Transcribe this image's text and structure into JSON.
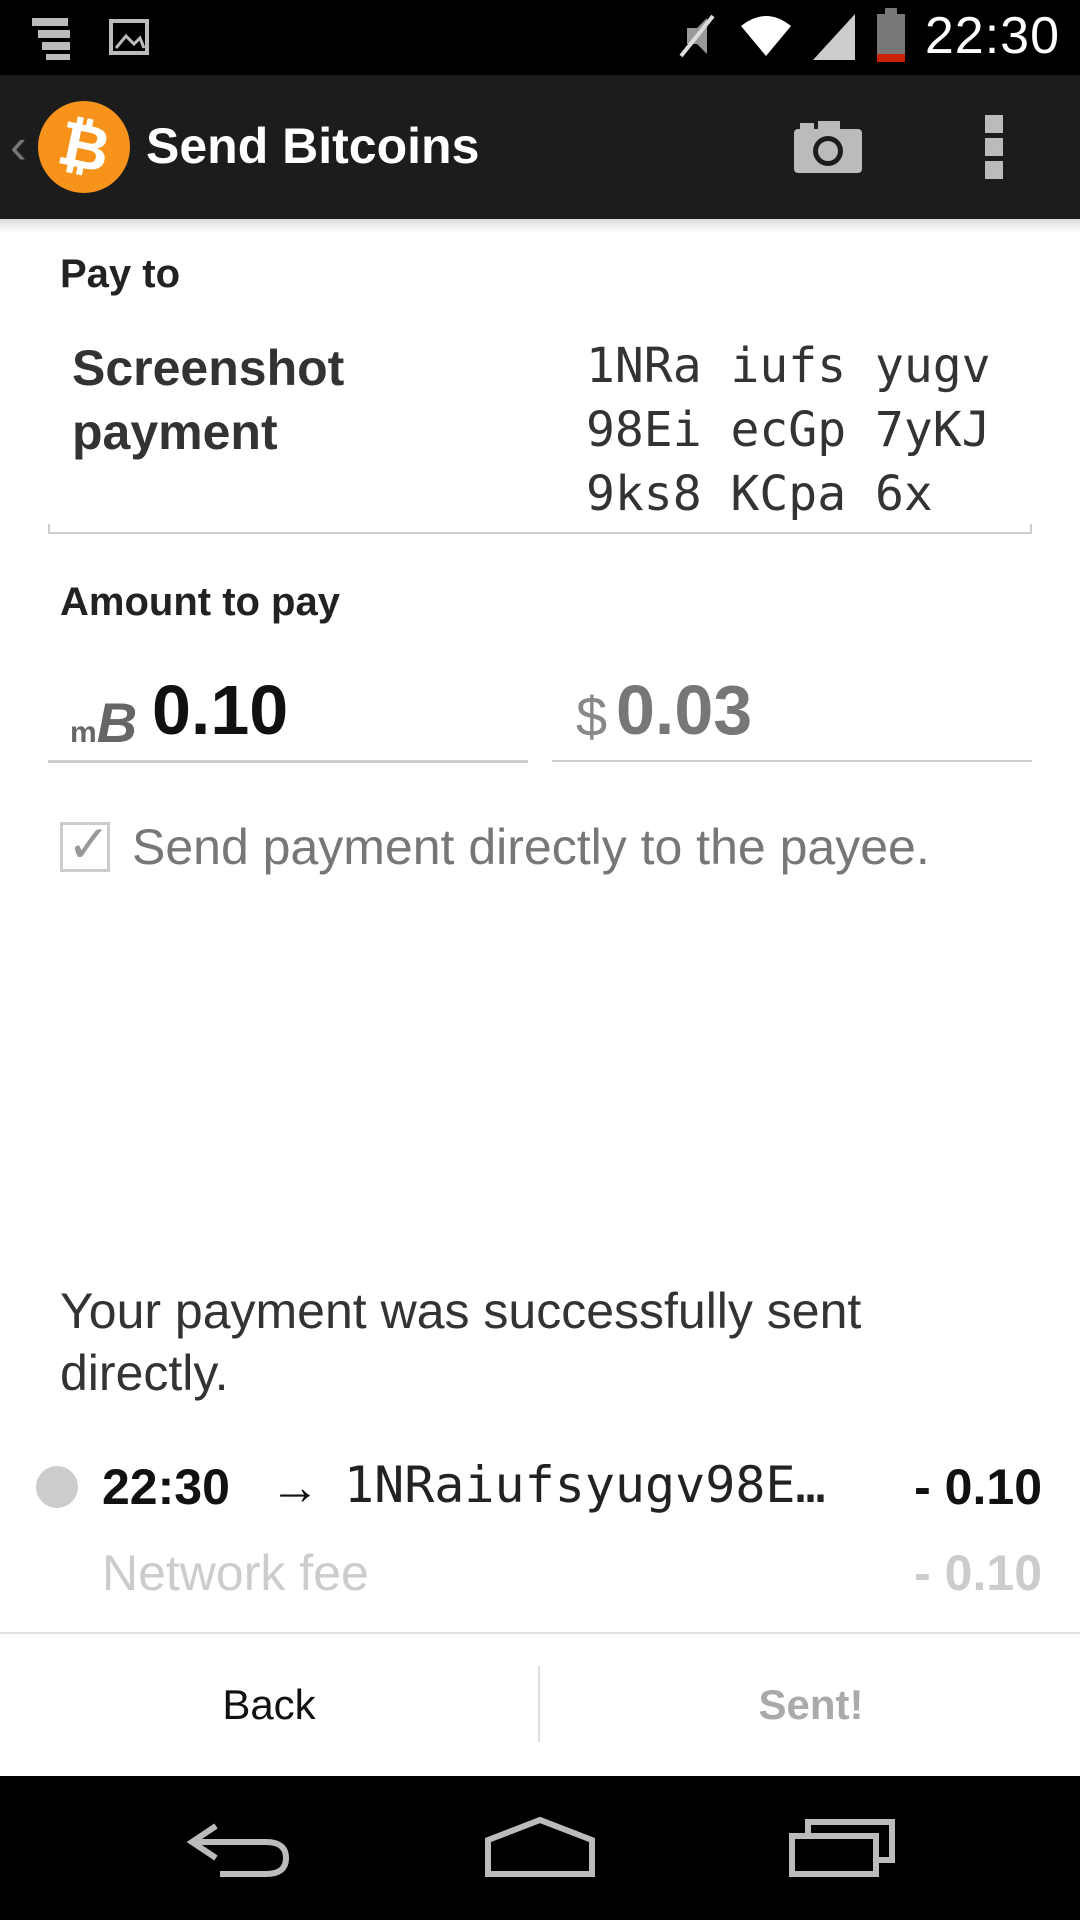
{
  "status_bar": {
    "time": "22:30",
    "icons": [
      "notification-stack-icon",
      "image-notification-icon",
      "mute-icon",
      "wifi-icon",
      "cell-signal-icon",
      "battery-low-icon"
    ]
  },
  "action_bar": {
    "title": "Send Bitcoins",
    "up_caret": "‹",
    "logo_glyph": "₿",
    "icons": [
      "bitcoin-logo-icon",
      "camera-icon",
      "overflow-menu-icon"
    ],
    "accent_color": "#f7931a"
  },
  "pay_to": {
    "label": "Pay to",
    "name": "Screenshot payment",
    "address_lines": [
      "1NRa iufs yugv",
      "98Ei ecGp 7yKJ",
      "9ks8 KCpa 6x"
    ]
  },
  "amount": {
    "label": "Amount to pay",
    "btc_prefix_m": "m",
    "btc_prefix_symbol": "B",
    "btc_value": "0.10",
    "fiat_prefix": "$",
    "fiat_value": "0.03"
  },
  "direct_payment": {
    "checked": true,
    "label": "Send payment directly to the payee."
  },
  "status_message": "Your payment was successfully sent directly.",
  "transaction": {
    "time": "22:30",
    "arrow": "→",
    "address": "1NRaiufsyugv98E…",
    "amount": "- 0.10",
    "fee_label": "Network fee",
    "fee_amount": "- 0.10"
  },
  "buttons": {
    "back": "Back",
    "sent": "Sent!"
  },
  "nav_bar": {
    "icons": [
      "back-nav-icon",
      "home-nav-icon",
      "recents-nav-icon"
    ]
  }
}
